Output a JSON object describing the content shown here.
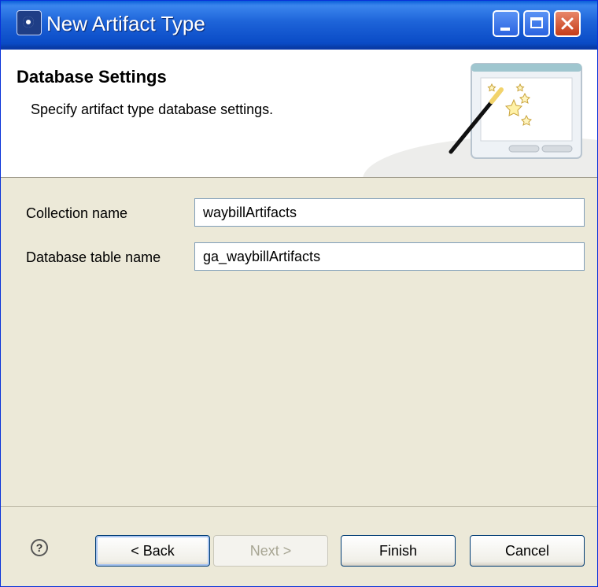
{
  "window": {
    "title": "New Artifact Type"
  },
  "header": {
    "title": "Database Settings",
    "description": "Specify artifact type database settings."
  },
  "form": {
    "collection_name_label": "Collection name",
    "collection_name_value": "waybillArtifacts",
    "db_table_label": "Database table name",
    "db_table_value": "ga_waybillArtifacts"
  },
  "buttons": {
    "help": "?",
    "back": "< Back",
    "next": "Next >",
    "finish": "Finish",
    "cancel": "Cancel"
  },
  "icons": [
    "app-icon",
    "minimize-icon",
    "maximize-icon",
    "close-icon",
    "wizard-wand-icon",
    "help-icon"
  ],
  "colors": {
    "titlebar": "#0a4bc6",
    "dialog_bg": "#ece9d8",
    "close_button": "#c53c18"
  },
  "state": {
    "next_enabled": false
  }
}
